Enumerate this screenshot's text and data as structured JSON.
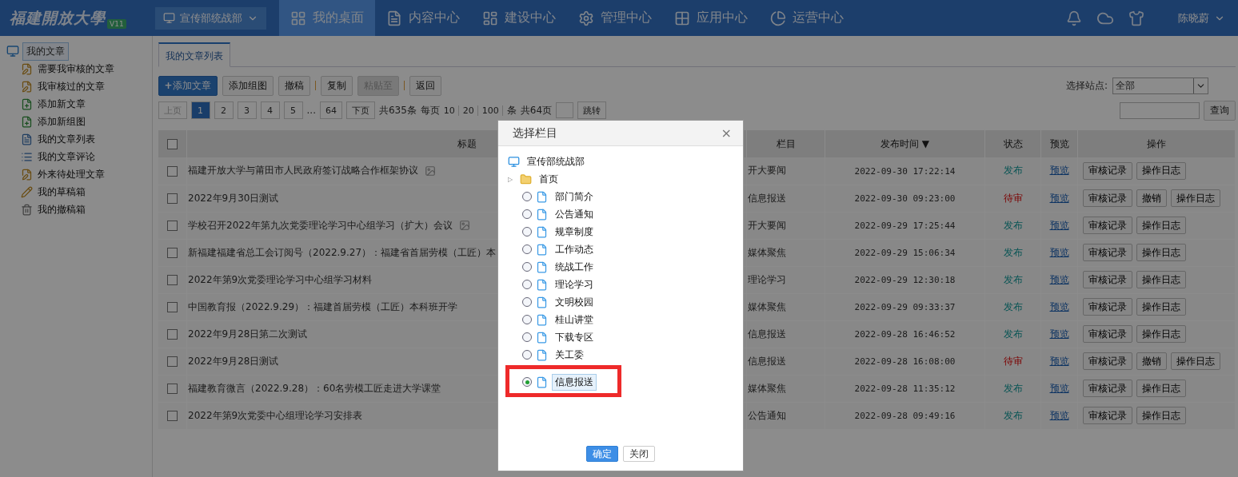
{
  "topbar": {
    "logo": "福建開放大學",
    "version": "V11",
    "department": "宣传部统战部",
    "nav": [
      {
        "label": "我的桌面",
        "selected": true
      },
      {
        "label": "内容中心",
        "selected": false
      },
      {
        "label": "建设中心",
        "selected": false
      },
      {
        "label": "管理中心",
        "selected": false
      },
      {
        "label": "应用中心",
        "selected": false
      },
      {
        "label": "运营中心",
        "selected": false
      }
    ],
    "user": "陈晓蔚"
  },
  "sidebar": {
    "root": {
      "label": "我的文章",
      "selected": true
    },
    "items": [
      {
        "label": "需要我审核的文章"
      },
      {
        "label": "我审核过的文章"
      },
      {
        "label": "添加新文章"
      },
      {
        "label": "添加新组图"
      },
      {
        "label": "我的文章列表"
      },
      {
        "label": "我的文章评论"
      },
      {
        "label": "外来待处理文章"
      },
      {
        "label": "我的草稿箱"
      },
      {
        "label": "我的撤稿箱"
      }
    ]
  },
  "tabs": [
    {
      "label": "我的文章列表",
      "selected": true
    }
  ],
  "toolbar": {
    "buttons": [
      {
        "label": "添加文章",
        "kind": "primary",
        "plus": "+"
      },
      {
        "label": "添加组图",
        "kind": "normal"
      },
      {
        "label": "撤稿",
        "kind": "normal"
      },
      {
        "label": "复制",
        "kind": "normal"
      },
      {
        "label": "粘贴至",
        "kind": "disabled"
      },
      {
        "label": "返回",
        "kind": "normal"
      }
    ],
    "site_label": "选择站点:",
    "site_value": "全部",
    "search_button": "查询"
  },
  "pagination": {
    "prev": "上页",
    "pages": [
      {
        "label": "1",
        "selected": true
      },
      {
        "label": "2",
        "selected": false
      },
      {
        "label": "3",
        "selected": false
      },
      {
        "label": "4",
        "selected": false
      },
      {
        "label": "5",
        "selected": false
      }
    ],
    "ellipsis": "...",
    "last": "64",
    "next": "下页",
    "total": "共635条",
    "per_page_label": "每页",
    "sizes": [
      "10",
      "20",
      "100"
    ],
    "unit": "条",
    "pages_total": "共64页",
    "jump": "跳转"
  },
  "table": {
    "select_all_checked": false,
    "columns": [
      "标题",
      "栏目",
      "发布时间",
      "状态",
      "预览",
      "操作"
    ],
    "sort_mark": "▼",
    "rows": [
      {
        "checked": false,
        "title": "福建开放大学与莆田市人民政府签订战略合作框架协议",
        "has_image": true,
        "column": "开大要闻",
        "time": "2022-09-30 17:22:14",
        "status": "发布",
        "kind": "published",
        "preview": "预览",
        "actions": [
          "审核记录",
          "操作日志"
        ]
      },
      {
        "checked": false,
        "title": "2022年9月30日测试",
        "has_image": false,
        "column": "信息报送",
        "time": "2022-09-30 09:23:00",
        "status": "待审",
        "kind": "pending",
        "preview": "预览",
        "actions": [
          "审核记录",
          "撤销",
          "操作日志"
        ]
      },
      {
        "checked": false,
        "title": "学校召开2022年第九次党委理论学习中心组学习（扩大）会议",
        "has_image": true,
        "column": "开大要闻",
        "time": "2022-09-29 17:25:44",
        "status": "发布",
        "kind": "published",
        "preview": "预览",
        "actions": [
          "审核记录",
          "操作日志"
        ]
      },
      {
        "checked": false,
        "title": "新福建福建省总工会订阅号（2022.9.27）：福建省首届劳模（工匠）本",
        "has_image": false,
        "column": "媒体聚焦",
        "time": "2022-09-29 15:06:34",
        "status": "发布",
        "kind": "published",
        "preview": "预览",
        "actions": [
          "审核记录",
          "操作日志"
        ]
      },
      {
        "checked": false,
        "title": "2022年第9次党委理论学习中心组学习材料",
        "has_image": false,
        "column": "理论学习",
        "time": "2022-09-29 12:30:18",
        "status": "发布",
        "kind": "published",
        "preview": "预览",
        "actions": [
          "审核记录",
          "操作日志"
        ]
      },
      {
        "checked": false,
        "title": "中国教育报（2022.9.29）：福建首届劳模（工匠）本科班开学",
        "has_image": false,
        "column": "媒体聚焦",
        "time": "2022-09-29 09:33:37",
        "status": "发布",
        "kind": "published",
        "preview": "预览",
        "actions": [
          "审核记录",
          "操作日志"
        ]
      },
      {
        "checked": false,
        "title": "2022年9月28日第二次测试",
        "has_image": false,
        "column": "信息报送",
        "time": "2022-09-28 16:46:52",
        "status": "发布",
        "kind": "published",
        "preview": "预览",
        "actions": [
          "审核记录",
          "操作日志"
        ]
      },
      {
        "checked": false,
        "title": "2022年9月28日测试",
        "has_image": false,
        "column": "信息报送",
        "time": "2022-09-28 16:08:00",
        "status": "待审",
        "kind": "pending",
        "preview": "预览",
        "actions": [
          "审核记录",
          "撤销",
          "操作日志"
        ]
      },
      {
        "checked": false,
        "title": "福建教育微言（2022.9.28）：60名劳模工匠走进大学课堂",
        "has_image": false,
        "column": "媒体聚焦",
        "time": "2022-09-28 11:35:12",
        "status": "发布",
        "kind": "published",
        "preview": "预览",
        "actions": [
          "审核记录",
          "操作日志"
        ]
      },
      {
        "checked": false,
        "title": "2022年第9次党委中心组理论学习安排表",
        "has_image": false,
        "column": "公告通知",
        "time": "2022-09-28 09:49:16",
        "status": "发布",
        "kind": "published",
        "preview": "预览",
        "actions": [
          "审核记录",
          "操作日志"
        ]
      }
    ]
  },
  "dialog": {
    "title": "选择栏目",
    "close": "×",
    "root": "宣传部统战部",
    "folder": {
      "label": "首页",
      "toggle": "▷"
    },
    "items": [
      {
        "label": "部门简介",
        "selected": false,
        "highlighted": false
      },
      {
        "label": "公告通知",
        "selected": false,
        "highlighted": false
      },
      {
        "label": "规章制度",
        "selected": false,
        "highlighted": false
      },
      {
        "label": "工作动态",
        "selected": false,
        "highlighted": false
      },
      {
        "label": "统战工作",
        "selected": false,
        "highlighted": false
      },
      {
        "label": "理论学习",
        "selected": false,
        "highlighted": false
      },
      {
        "label": "文明校园",
        "selected": false,
        "highlighted": false
      },
      {
        "label": "桂山讲堂",
        "selected": false,
        "highlighted": false
      },
      {
        "label": "下载专区",
        "selected": false,
        "highlighted": false
      },
      {
        "label": "关工委",
        "selected": false,
        "highlighted": false
      },
      {
        "label": "信息报送",
        "selected": true,
        "highlighted": true
      }
    ],
    "buttons": [
      {
        "label": "确定",
        "kind": "primary"
      },
      {
        "label": "关闭",
        "kind": "normal"
      }
    ]
  }
}
